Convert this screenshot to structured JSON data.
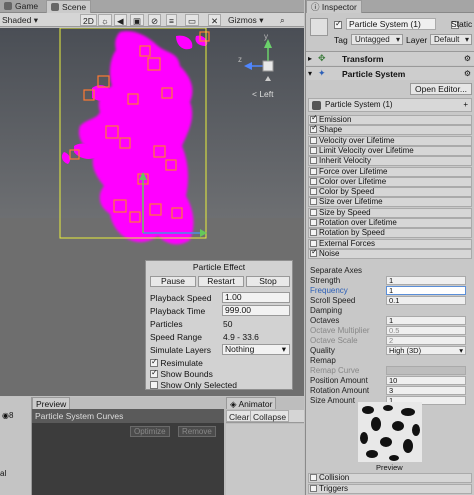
{
  "top_tabs": {
    "game": "Game",
    "scene": "Scene"
  },
  "scene_toolbar": {
    "shading": "Shaded",
    "mode_2d": "2D",
    "gizmos": "Gizmos"
  },
  "gizmo": {
    "view_label": "< Left",
    "axis_y": "y",
    "axis_z": "z"
  },
  "particle_effect": {
    "title": "Particle Effect",
    "pause": "Pause",
    "restart": "Restart",
    "stop": "Stop",
    "rows": {
      "playback_speed_label": "Playback Speed",
      "playback_speed": "1.00",
      "playback_time_label": "Playback Time",
      "playback_time": "999.00",
      "particles_label": "Particles",
      "particles": "50",
      "speed_range_label": "Speed Range",
      "speed_range": "4.9 - 33.6",
      "simulate_layers_label": "Simulate Layers",
      "simulate_layers": "Nothing"
    },
    "resimulate": "Resimulate",
    "show_bounds": "Show Bounds",
    "show_only_selected": "Show Only Selected"
  },
  "bottom": {
    "preview_tab": "Preview",
    "curves_title": "Particle System Curves",
    "optimize": "Optimize",
    "remove": "Remove",
    "animator_tab": "Animator",
    "clear": "Clear",
    "collapse": "Collapse",
    "left_count": "8",
    "left_label": "al"
  },
  "inspector": {
    "tab": "Inspector",
    "object_name": "Particle System (1)",
    "static_label": "Static",
    "tag_label": "Tag",
    "tag_value": "Untagged",
    "layer_label": "Layer",
    "layer_value": "Default",
    "transform": "Transform",
    "particle_system": "Particle System",
    "open_editor": "Open Editor...",
    "ps_header": "Particle System (1)",
    "modules": [
      {
        "label": "Emission",
        "on": true
      },
      {
        "label": "Shape",
        "on": true
      },
      {
        "label": "Velocity over Lifetime",
        "on": false
      },
      {
        "label": "Limit Velocity over Lifetime",
        "on": false
      },
      {
        "label": "Inherit Velocity",
        "on": false
      },
      {
        "label": "Force over Lifetime",
        "on": false
      },
      {
        "label": "Color over Lifetime",
        "on": false
      },
      {
        "label": "Color by Speed",
        "on": false
      },
      {
        "label": "Size over Lifetime",
        "on": false
      },
      {
        "label": "Size by Speed",
        "on": false
      },
      {
        "label": "Rotation over Lifetime",
        "on": false
      },
      {
        "label": "Rotation by Speed",
        "on": false
      },
      {
        "label": "External Forces",
        "on": false
      },
      {
        "label": "Noise",
        "on": true
      }
    ],
    "noise": {
      "separate_axes": "Separate Axes",
      "strength": "Strength",
      "strength_val": "1",
      "frequency": "Frequency",
      "frequency_val": "1",
      "scroll_speed": "Scroll Speed",
      "scroll_speed_val": "0.1",
      "damping": "Damping",
      "octaves": "Octaves",
      "octaves_val": "1",
      "octave_multiplier": "Octave Multiplier",
      "octave_multiplier_val": "0.5",
      "octave_scale": "Octave Scale",
      "octave_scale_val": "2",
      "quality": "Quality",
      "quality_val": "High (3D)",
      "remap": "Remap",
      "remap_curve": "Remap Curve",
      "position_amount": "Position Amount",
      "position_amount_val": "10",
      "rotation_amount": "Rotation Amount",
      "rotation_amount_val": "3",
      "size_amount": "Size Amount",
      "size_amount_val": "1",
      "preview": "Preview"
    },
    "after_modules": [
      {
        "label": "Collision",
        "on": false
      },
      {
        "label": "Triggers",
        "on": false
      }
    ]
  },
  "colors": {
    "particles": "#ff00ff",
    "bounds": "#e8ef3c",
    "frequency_label": "#2b5fb8"
  }
}
